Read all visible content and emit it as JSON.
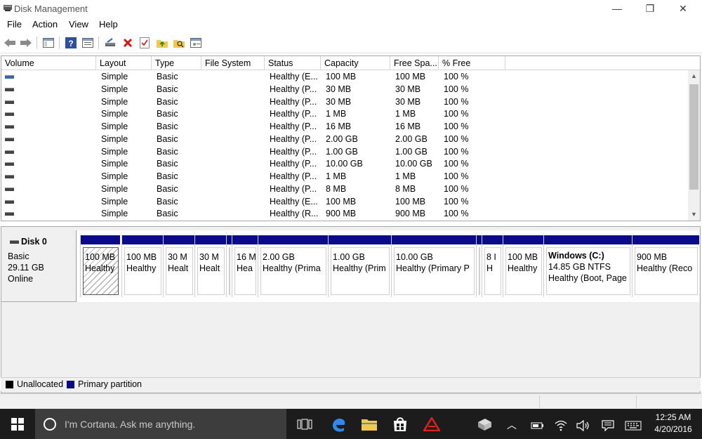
{
  "window": {
    "title": "Disk Management",
    "minimize_glyph": "—",
    "restore_glyph": "❐",
    "close_glyph": "✕"
  },
  "menu": [
    "File",
    "Action",
    "View",
    "Help"
  ],
  "toolbar_icons": [
    "back-icon",
    "forward-icon",
    "console-tree-icon",
    "help-icon",
    "properties-icon",
    "connect-icon",
    "delete-icon",
    "check-icon",
    "open-folder-icon",
    "explore-icon",
    "settings-icon"
  ],
  "columns": [
    "Volume",
    "Layout",
    "Type",
    "File System",
    "Status",
    "Capacity",
    "Free Spa...",
    "% Free"
  ],
  "volumes": [
    {
      "volume": "",
      "layout": "Simple",
      "type": "Basic",
      "fs": "",
      "status": "Healthy (E...",
      "capacity": "100 MB",
      "free": "100 MB",
      "pct": "100 %"
    },
    {
      "volume": "",
      "layout": "Simple",
      "type": "Basic",
      "fs": "",
      "status": "Healthy (P...",
      "capacity": "30 MB",
      "free": "30 MB",
      "pct": "100 %"
    },
    {
      "volume": "",
      "layout": "Simple",
      "type": "Basic",
      "fs": "",
      "status": "Healthy (P...",
      "capacity": "30 MB",
      "free": "30 MB",
      "pct": "100 %"
    },
    {
      "volume": "",
      "layout": "Simple",
      "type": "Basic",
      "fs": "",
      "status": "Healthy (P...",
      "capacity": "1 MB",
      "free": "1 MB",
      "pct": "100 %"
    },
    {
      "volume": "",
      "layout": "Simple",
      "type": "Basic",
      "fs": "",
      "status": "Healthy (P...",
      "capacity": "16 MB",
      "free": "16 MB",
      "pct": "100 %"
    },
    {
      "volume": "",
      "layout": "Simple",
      "type": "Basic",
      "fs": "",
      "status": "Healthy (P...",
      "capacity": "2.00 GB",
      "free": "2.00 GB",
      "pct": "100 %"
    },
    {
      "volume": "",
      "layout": "Simple",
      "type": "Basic",
      "fs": "",
      "status": "Healthy (P...",
      "capacity": "1.00 GB",
      "free": "1.00 GB",
      "pct": "100 %"
    },
    {
      "volume": "",
      "layout": "Simple",
      "type": "Basic",
      "fs": "",
      "status": "Healthy (P...",
      "capacity": "10.00 GB",
      "free": "10.00 GB",
      "pct": "100 %"
    },
    {
      "volume": "",
      "layout": "Simple",
      "type": "Basic",
      "fs": "",
      "status": "Healthy (P...",
      "capacity": "1 MB",
      "free": "1 MB",
      "pct": "100 %"
    },
    {
      "volume": "",
      "layout": "Simple",
      "type": "Basic",
      "fs": "",
      "status": "Healthy (P...",
      "capacity": "8 MB",
      "free": "8 MB",
      "pct": "100 %"
    },
    {
      "volume": "",
      "layout": "Simple",
      "type": "Basic",
      "fs": "",
      "status": "Healthy (E...",
      "capacity": "100 MB",
      "free": "100 MB",
      "pct": "100 %"
    },
    {
      "volume": "",
      "layout": "Simple",
      "type": "Basic",
      "fs": "",
      "status": "Healthy (R...",
      "capacity": "900 MB",
      "free": "900 MB",
      "pct": "100 %"
    }
  ],
  "disk": {
    "name": "Disk 0",
    "type": "Basic",
    "size": "29.11 GB",
    "state": "Online"
  },
  "partitions": [
    {
      "title": "",
      "size": "100 MB",
      "status": "Healthy"
    },
    {
      "title": "",
      "size": "100 MB",
      "status": "Healthy"
    },
    {
      "title": "",
      "size": "30 M",
      "status": "Healt"
    },
    {
      "title": "",
      "size": "30 M",
      "status": "Healt"
    },
    {
      "title": "",
      "size": "",
      "status": ""
    },
    {
      "title": "",
      "size": "16 M",
      "status": "Hea"
    },
    {
      "title": "",
      "size": "2.00 GB",
      "status": "Healthy (Prima"
    },
    {
      "title": "",
      "size": "1.00 GB",
      "status": "Healthy (Prim"
    },
    {
      "title": "",
      "size": "10.00 GB",
      "status": "Healthy (Primary P"
    },
    {
      "title": "",
      "size": "",
      "status": ""
    },
    {
      "title": "",
      "size": "8 I",
      "status": "H"
    },
    {
      "title": "",
      "size": "100 MB",
      "status": "Healthy"
    },
    {
      "title": "Windows  (C:)",
      "size": "14.85 GB NTFS",
      "status": "Healthy (Boot, Page"
    },
    {
      "title": "",
      "size": "900 MB",
      "status": "Healthy (Reco"
    }
  ],
  "legend": [
    {
      "label": "Unallocated",
      "color": "#000000"
    },
    {
      "label": "Primary partition",
      "color": "#0a0a8a"
    }
  ],
  "taskbar": {
    "search_placeholder": "I'm Cortana. Ask me anything.",
    "time": "12:25 AM",
    "date": "4/20/2016"
  }
}
